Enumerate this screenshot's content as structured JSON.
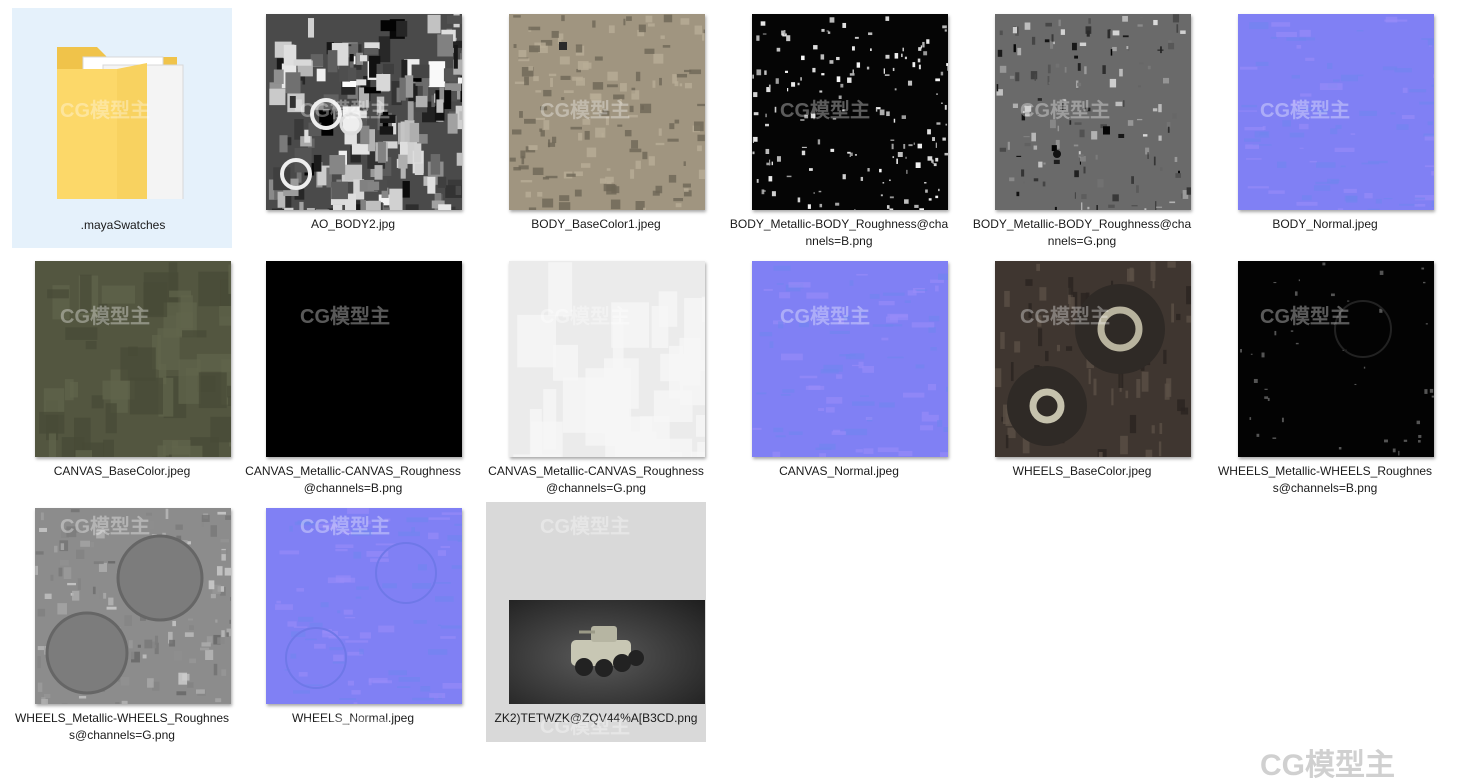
{
  "files": [
    {
      "name": ".mayaSwatches",
      "kind": "folder",
      "icon": "folder-icon",
      "selected": true
    },
    {
      "name": "AO_BODY2.jpg",
      "kind": "ao"
    },
    {
      "name": "BODY_BaseColor1.jpeg",
      "kind": "tan"
    },
    {
      "name": "BODY_Metallic-BODY_Roughness@channels=B.png",
      "kind": "black-speckle"
    },
    {
      "name": "BODY_Metallic-BODY_Roughness@channels=G.png",
      "kind": "gray-speckle"
    },
    {
      "name": "BODY_Normal.jpeg",
      "kind": "normal"
    },
    {
      "name": "CANVAS_BaseColor.jpeg",
      "kind": "olive"
    },
    {
      "name": "CANVAS_Metallic-CANVAS_Roughness@channels=B.png",
      "kind": "black"
    },
    {
      "name": "CANVAS_Metallic-CANVAS_Roughness@channels=G.png",
      "kind": "white"
    },
    {
      "name": "CANVAS_Normal.jpeg",
      "kind": "normal"
    },
    {
      "name": "WHEELS_BaseColor.jpeg",
      "kind": "wheels-color"
    },
    {
      "name": "WHEELS_Metallic-WHEELS_Roughness@channels=B.png",
      "kind": "wheels-dark"
    },
    {
      "name": "WHEELS_Metallic-WHEELS_Roughness@channels=G.png",
      "kind": "wheels-gray"
    },
    {
      "name": "WHEELS_Normal.jpeg",
      "kind": "normal"
    },
    {
      "name": "ZK2)TETWZK@ZQV44%A[B3CD.png",
      "kind": "render",
      "hover": true
    }
  ],
  "watermark": "CG模型主",
  "colors": {
    "selected_bg": "#e5f1fb",
    "hover_bg": "#d9d9d9",
    "normal_map": "#7f7ff5"
  }
}
